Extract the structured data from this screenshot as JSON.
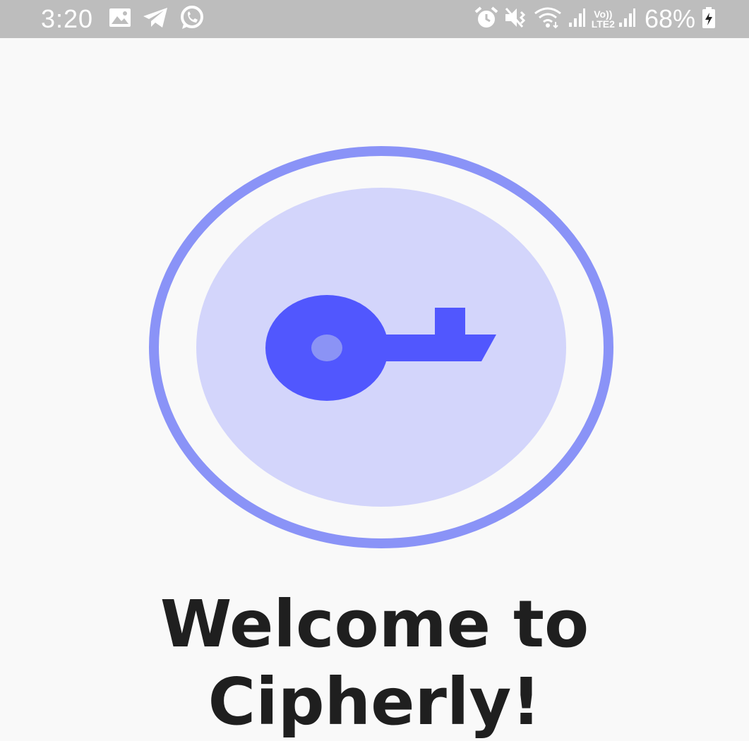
{
  "status_bar": {
    "time": "3:20",
    "lte_top": "Vo))",
    "lte_bottom": "LTE2",
    "battery_percent": "68%",
    "icons": [
      "gallery-icon",
      "telegram-icon",
      "whatsapp-icon",
      "alarm-icon",
      "vibrate-icon",
      "wifi-icon",
      "signal-icon",
      "signal-icon-2",
      "battery-charging-icon"
    ]
  },
  "onboarding": {
    "title_line1": "Welcome to",
    "title_line2": "Cipherly!",
    "logo_icon": "key-icon"
  },
  "colors": {
    "status_bar_bg": "#bdbdbd",
    "background": "#f9f9f9",
    "ring": "#8a93f7",
    "inner_circle": "#d3d5fb",
    "key": "#5157fe",
    "key_hole": "#8b93f5",
    "title_text": "#1f1f1f"
  }
}
